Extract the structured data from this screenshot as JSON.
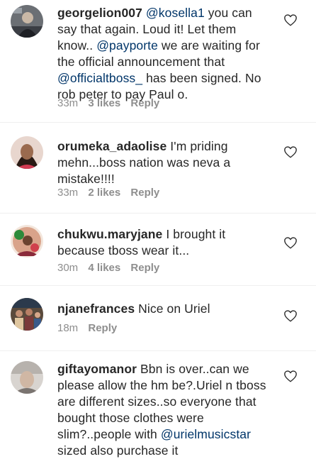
{
  "comments": [
    {
      "username": "georgelion007",
      "segments": [
        {
          "type": "mention",
          "text": "@kosella1"
        },
        {
          "type": "text",
          "text": " you can say that again. Loud it! Let them know.. "
        },
        {
          "type": "mention",
          "text": "@payporte"
        },
        {
          "type": "text",
          "text": " we are waiting for the official announcement that "
        },
        {
          "type": "mention",
          "text": "@officialtboss_"
        },
        {
          "type": "text",
          "text": " has been signed. No rob peter to pay Paul o."
        }
      ],
      "time": "33m",
      "likes": "3 likes",
      "reply": "Reply"
    },
    {
      "username": "orumeka_adaolise",
      "segments": [
        {
          "type": "text",
          "text": " I'm priding mehn...boss nation was neva a mistake!!!!"
        }
      ],
      "time": "33m",
      "likes": "2 likes",
      "reply": "Reply"
    },
    {
      "username": "chukwu.maryjane",
      "segments": [
        {
          "type": "text",
          "text": " I brought it because tboss wear it..."
        }
      ],
      "time": "30m",
      "likes": "4 likes",
      "reply": "Reply"
    },
    {
      "username": "njanefrances",
      "segments": [
        {
          "type": "text",
          "text": " Nice on Uriel"
        }
      ],
      "time": "18m",
      "likes": "",
      "reply": "Reply"
    },
    {
      "username": "giftayomanor",
      "segments": [
        {
          "type": "text",
          "text": " Bbn is over..can we please allow the hm be?.Uriel n tboss are different sizes..so everyone that bought those clothes were slim?..people with "
        },
        {
          "type": "mention",
          "text": "@urielmusicstar"
        },
        {
          "type": "text",
          "text": " sized also purchase it"
        }
      ],
      "time": "",
      "likes": "",
      "reply": ""
    }
  ]
}
